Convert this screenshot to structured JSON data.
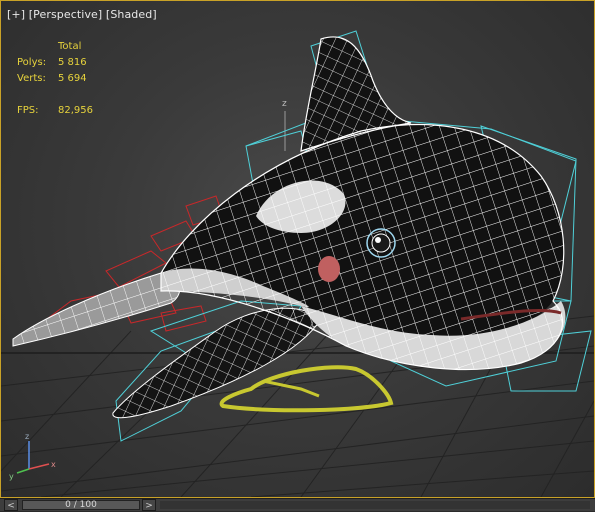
{
  "viewport": {
    "label_plus": "[+]",
    "label_view": "[Perspective]",
    "label_shading": "[Shaded]",
    "stats": {
      "header": "Total",
      "polys_label": "Polys:",
      "polys_value": "5 816",
      "verts_label": "Verts:",
      "verts_value": "5 694",
      "fps_label": "FPS:",
      "fps_value": "82,956"
    },
    "axis_z": "z",
    "axis_labels": {
      "x": "x",
      "y": "y",
      "z": "z"
    }
  },
  "timeline": {
    "prev_label": "<",
    "frame_text": "0 / 100",
    "next_label": ">"
  },
  "colors": {
    "viewport_border": "#c9a227",
    "stats_text": "#e6d23c",
    "wireframe": "#ffffff",
    "bone_red": "#c8282a",
    "bone_cyan": "#4fd0d8",
    "control_yellow": "#c8c830",
    "orca_black": "#101010",
    "orca_white": "#dcdcdc"
  }
}
